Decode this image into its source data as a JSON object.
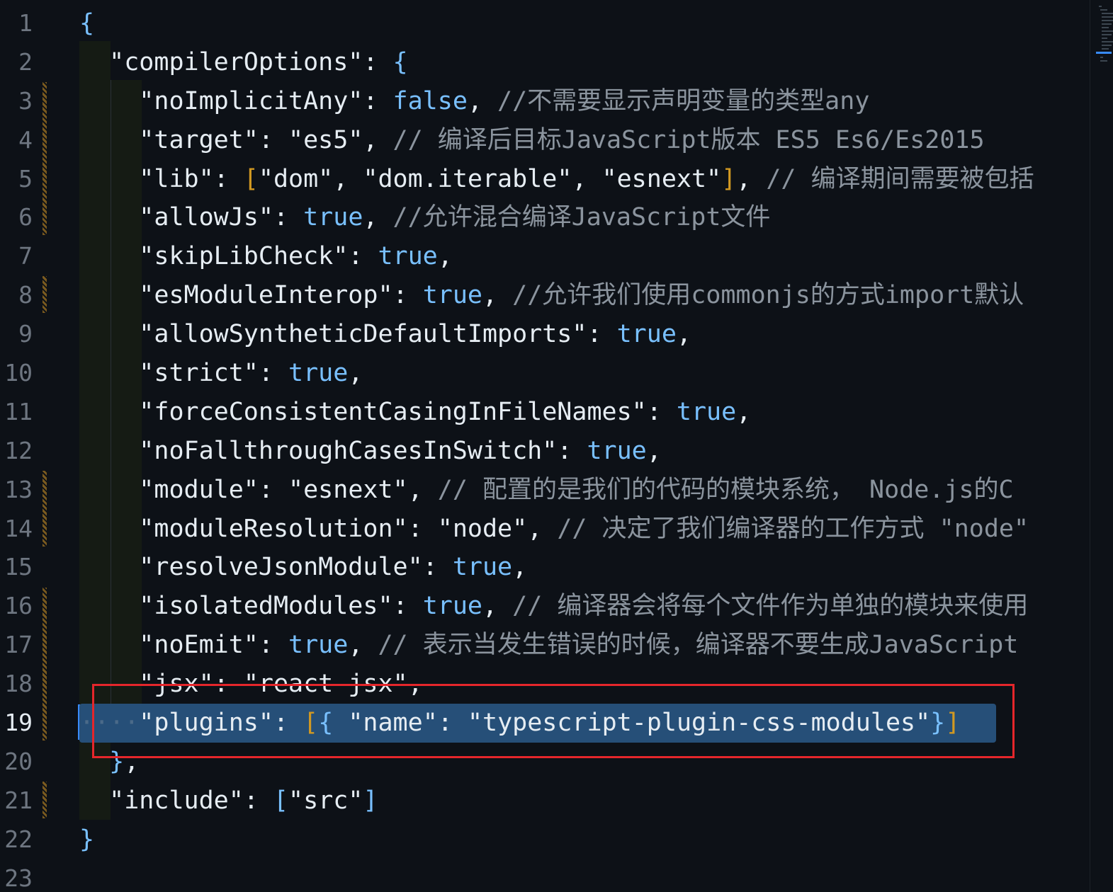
{
  "editor": {
    "active_line": 19,
    "line_numbers": [
      "1",
      "2",
      "3",
      "4",
      "5",
      "6",
      "7",
      "8",
      "9",
      "10",
      "11",
      "12",
      "13",
      "14",
      "15",
      "16",
      "17",
      "18",
      "19",
      "20",
      "21",
      "22",
      "23"
    ],
    "lines": {
      "l1": {
        "brace": "{"
      },
      "l2": {
        "key": "\"compilerOptions\"",
        "sep": ": ",
        "brace": "{"
      },
      "l3": {
        "key": "\"noImplicitAny\"",
        "sep": ": ",
        "value": "false",
        "comma": ",",
        "comment": " //不需要显示声明变量的类型any"
      },
      "l4": {
        "key": "\"target\"",
        "sep": ": ",
        "value": "\"es5\"",
        "comma": ",",
        "comment": " // 编译后目标JavaScript版本 ES5 Es6/Es2015"
      },
      "l5": {
        "key": "\"lib\"",
        "sep": ": ",
        "open": "[",
        "items": "\"dom\", \"dom.iterable\", \"esnext\"",
        "close": "]",
        "comma": ",",
        "comment": " // 编译期间需要被包括"
      },
      "l6": {
        "key": "\"allowJs\"",
        "sep": ": ",
        "value": "true",
        "comma": ",",
        "comment": " //允许混合编译JavaScript文件"
      },
      "l7": {
        "key": "\"skipLibCheck\"",
        "sep": ": ",
        "value": "true",
        "comma": ","
      },
      "l8": {
        "key": "\"esModuleInterop\"",
        "sep": ": ",
        "value": "true",
        "comma": ",",
        "comment": " //允许我们使用commonjs的方式import默认"
      },
      "l9": {
        "key": "\"allowSyntheticDefaultImports\"",
        "sep": ": ",
        "value": "true",
        "comma": ","
      },
      "l10": {
        "key": "\"strict\"",
        "sep": ": ",
        "value": "true",
        "comma": ","
      },
      "l11": {
        "key": "\"forceConsistentCasingInFileNames\"",
        "sep": ": ",
        "value": "true",
        "comma": ","
      },
      "l12": {
        "key": "\"noFallthroughCasesInSwitch\"",
        "sep": ": ",
        "value": "true",
        "comma": ","
      },
      "l13": {
        "key": "\"module\"",
        "sep": ": ",
        "value": "\"esnext\"",
        "comma": ",",
        "comment": " // 配置的是我们的代码的模块系统， Node.js的C"
      },
      "l14": {
        "key": "\"moduleResolution\"",
        "sep": ": ",
        "value": "\"node\"",
        "comma": ",",
        "comment": " // 决定了我们编译器的工作方式 \"node\""
      },
      "l15": {
        "key": "\"resolveJsonModule\"",
        "sep": ": ",
        "value": "true",
        "comma": ","
      },
      "l16": {
        "key": "\"isolatedModules\"",
        "sep": ": ",
        "value": "true",
        "comma": ",",
        "comment": " // 编译器会将每个文件作为单独的模块来使用"
      },
      "l17": {
        "key": "\"noEmit\"",
        "sep": ": ",
        "value": "true",
        "comma": ",",
        "comment": " // 表示当发生错误的时候，编译器不要生成JavaScript"
      },
      "l18": {
        "key": "\"jsx\"",
        "sep": ": ",
        "value": "\"react-jsx\"",
        "comma": ","
      },
      "l19": {
        "key": "\"plugins\"",
        "sep": ": ",
        "open": "[",
        "obrace": "{",
        "name_key": " \"name\"",
        "name_sep": ": ",
        "name_val": "\"typescript-plugin-css-modules\"",
        "cbrace": "}",
        "close": "]"
      },
      "l20": {
        "brace": "}",
        "comma": ","
      },
      "l21": {
        "key": "\"include\"",
        "sep": ": ",
        "open": "[",
        "items": "\"src\"",
        "close": "]"
      },
      "l22": {
        "brace": "}"
      }
    }
  },
  "colors": {
    "background": "#0d1117",
    "selection": "#264f78",
    "annotation_box": "#e5262b",
    "boolean": "#79c0ff",
    "bracket_gold": "#d29922",
    "comment": "#8b949e"
  }
}
